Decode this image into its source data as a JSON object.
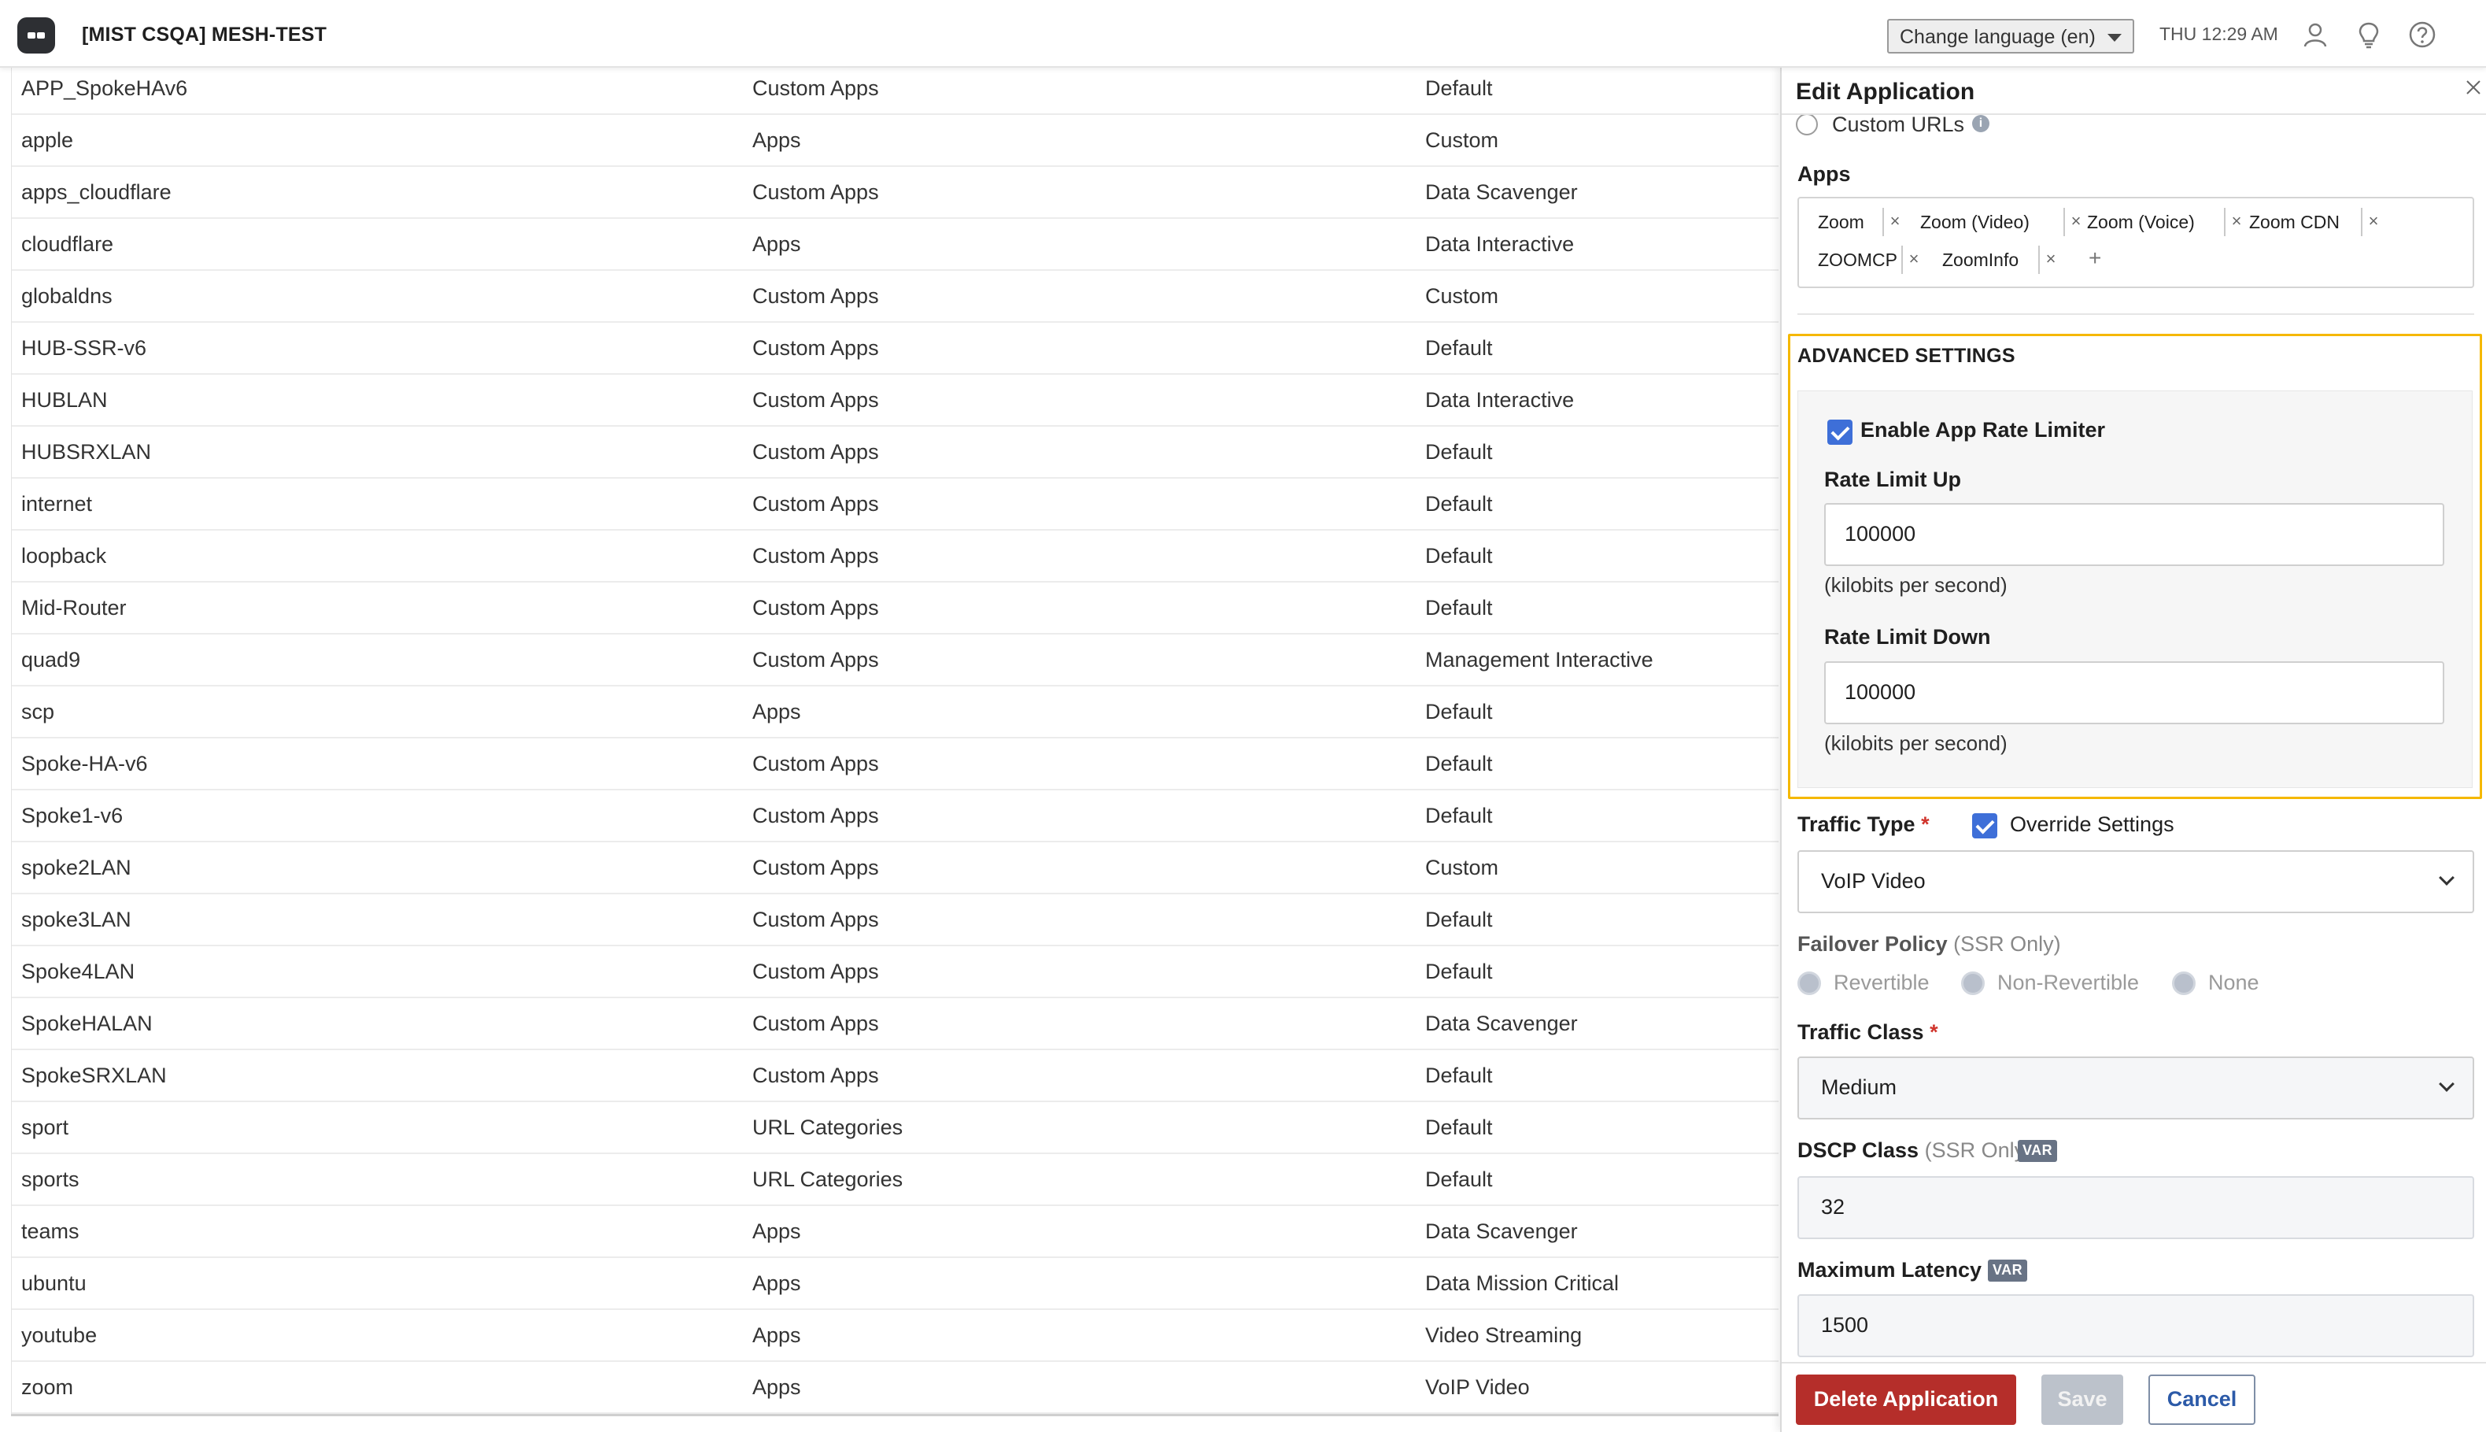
{
  "header": {
    "org_title": "[MIST CSQA] MESH-TEST",
    "language_select": "Change language (en)",
    "clock": "THU 12:29 AM",
    "icons": [
      "user-icon",
      "lightbulb-icon",
      "help-icon"
    ]
  },
  "table": {
    "rows": [
      {
        "name": "APP_SpokeHAv6",
        "type": "Custom Apps",
        "traffic": "Default"
      },
      {
        "name": "apple",
        "type": "Apps",
        "traffic": "Custom"
      },
      {
        "name": "apps_cloudflare",
        "type": "Custom Apps",
        "traffic": "Data Scavenger"
      },
      {
        "name": "cloudflare",
        "type": "Apps",
        "traffic": "Data Interactive"
      },
      {
        "name": "globaldns",
        "type": "Custom Apps",
        "traffic": "Custom"
      },
      {
        "name": "HUB-SSR-v6",
        "type": "Custom Apps",
        "traffic": "Default"
      },
      {
        "name": "HUBLAN",
        "type": "Custom Apps",
        "traffic": "Data Interactive"
      },
      {
        "name": "HUBSRXLAN",
        "type": "Custom Apps",
        "traffic": "Default"
      },
      {
        "name": "internet",
        "type": "Custom Apps",
        "traffic": "Default"
      },
      {
        "name": "loopback",
        "type": "Custom Apps",
        "traffic": "Default"
      },
      {
        "name": "Mid-Router",
        "type": "Custom Apps",
        "traffic": "Default"
      },
      {
        "name": "quad9",
        "type": "Custom Apps",
        "traffic": "Management Interactive"
      },
      {
        "name": "scp",
        "type": "Apps",
        "traffic": "Default"
      },
      {
        "name": "Spoke-HA-v6",
        "type": "Custom Apps",
        "traffic": "Default"
      },
      {
        "name": "Spoke1-v6",
        "type": "Custom Apps",
        "traffic": "Default"
      },
      {
        "name": "spoke2LAN",
        "type": "Custom Apps",
        "traffic": "Custom"
      },
      {
        "name": "spoke3LAN",
        "type": "Custom Apps",
        "traffic": "Default"
      },
      {
        "name": "Spoke4LAN",
        "type": "Custom Apps",
        "traffic": "Default"
      },
      {
        "name": "SpokeHALAN",
        "type": "Custom Apps",
        "traffic": "Data Scavenger"
      },
      {
        "name": "SpokeSRXLAN",
        "type": "Custom Apps",
        "traffic": "Default"
      },
      {
        "name": "sport",
        "type": "URL Categories",
        "traffic": "Default"
      },
      {
        "name": "sports",
        "type": "URL Categories",
        "traffic": "Default"
      },
      {
        "name": "teams",
        "type": "Apps",
        "traffic": "Data Scavenger"
      },
      {
        "name": "ubuntu",
        "type": "Apps",
        "traffic": "Data Mission Critical"
      },
      {
        "name": "youtube",
        "type": "Apps",
        "traffic": "Video Streaming"
      },
      {
        "name": "zoom",
        "type": "Apps",
        "traffic": "VoIP Video"
      }
    ]
  },
  "panel": {
    "title": "Edit Application",
    "custom_urls_label": "Custom URLs",
    "info_glyph": "i",
    "apps_label": "Apps",
    "apps_chips": [
      "Zoom",
      "Zoom (Video)",
      "Zoom (Voice)",
      "Zoom CDN",
      "ZOOMCP",
      "ZoomInfo"
    ],
    "chip_remove_glyph": "×",
    "chip_add_glyph": "+",
    "advanced": {
      "title": "ADVANCED SETTINGS",
      "enable_rate_limiter_label": "Enable App Rate Limiter",
      "enable_rate_limiter_checked": true,
      "rate_limit_up_label": "Rate Limit Up",
      "rate_limit_up_value": "100000",
      "rate_limit_up_hint": "(kilobits per second)",
      "rate_limit_down_label": "Rate Limit Down",
      "rate_limit_down_value": "100000",
      "rate_limit_down_hint": "(kilobits per second)"
    },
    "traffic_type_label": "Traffic Type",
    "required_mark": "*",
    "override_settings_label": "Override Settings",
    "override_settings_checked": true,
    "traffic_type_value": "VoIP Video",
    "failover_policy_label": "Failover Policy",
    "ssr_only_note": "(SSR Only)",
    "failover_options": [
      "Revertible",
      "Non-Revertible",
      "None"
    ],
    "traffic_class_label": "Traffic Class",
    "traffic_class_value": "Medium",
    "dscp_class_label": "DSCP Class",
    "var_badge": "VAR",
    "dscp_class_value": "32",
    "max_latency_label": "Maximum Latency",
    "max_latency_value": "1500",
    "buttons": {
      "delete": "Delete Application",
      "save": "Save",
      "cancel": "Cancel"
    }
  },
  "colors": {
    "accent_blue": "#3e6fd8",
    "highlight_border": "#f5b800",
    "delete_red": "#b52e2a",
    "required_red": "#d0342c"
  }
}
